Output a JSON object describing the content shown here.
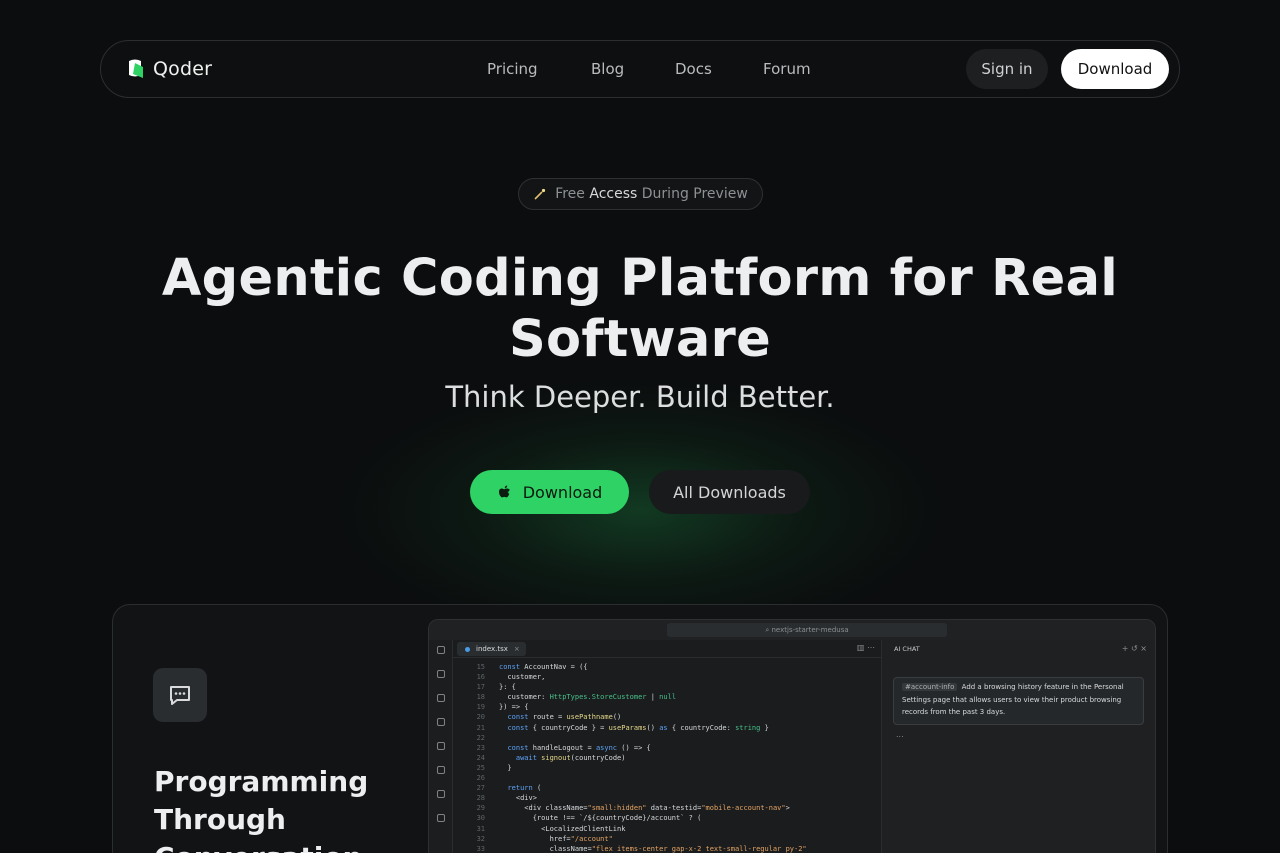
{
  "nav": {
    "brand": "Qoder",
    "links": [
      "Pricing",
      "Blog",
      "Docs",
      "Forum"
    ],
    "signin_label": "Sign in",
    "download_label": "Download"
  },
  "hero": {
    "badge": {
      "pre": "Free",
      "highlight": "Access",
      "post": "During Preview"
    },
    "title": "Agentic Coding Platform for Real Software",
    "subtitle": "Think Deeper. Build Better.",
    "primary_button": "Download",
    "secondary_button": "All Downloads"
  },
  "feature": {
    "title": "Programming Through Conversation",
    "ide": {
      "search": "nextjs-starter-medusa",
      "tab": "index.tsx",
      "chat_header": "AI CHAT",
      "chat_chip": "#account-info",
      "chat_message": "Add a browsing history feature in the Personal Settings page that allows users to view their product browsing records from the past 3 days.",
      "chat_more": "...",
      "line_numbers": [
        "15",
        "16",
        "17",
        "18",
        "19",
        "20",
        "21",
        "22",
        "23",
        "24",
        "25",
        "26",
        "27",
        "28",
        "29",
        "30",
        "31",
        "32",
        "33"
      ],
      "code_lines": [
        "const AccountNav = ({",
        "  customer,",
        "}: {",
        "  customer: HttpTypes.StoreCustomer | null",
        "}) => {",
        "  const route = usePathname()",
        "  const { countryCode } = useParams() as { countryCode: string }",
        "",
        "  const handleLogout = async () => {",
        "    await signout(countryCode)",
        "  }",
        "",
        "  return (",
        "    <div>",
        "      <div className=\"small:hidden\" data-testid=\"mobile-account-nav\">",
        "        {route !== `/${countryCode}/account` ? (",
        "          <LocalizedClientLink",
        "            href=\"/account\"",
        "            className=\"flex items-center gap-x-2 text-small-regular py-2\""
      ]
    }
  },
  "colors": {
    "accent_green": "#2fd365",
    "background": "#0b0d0e"
  }
}
